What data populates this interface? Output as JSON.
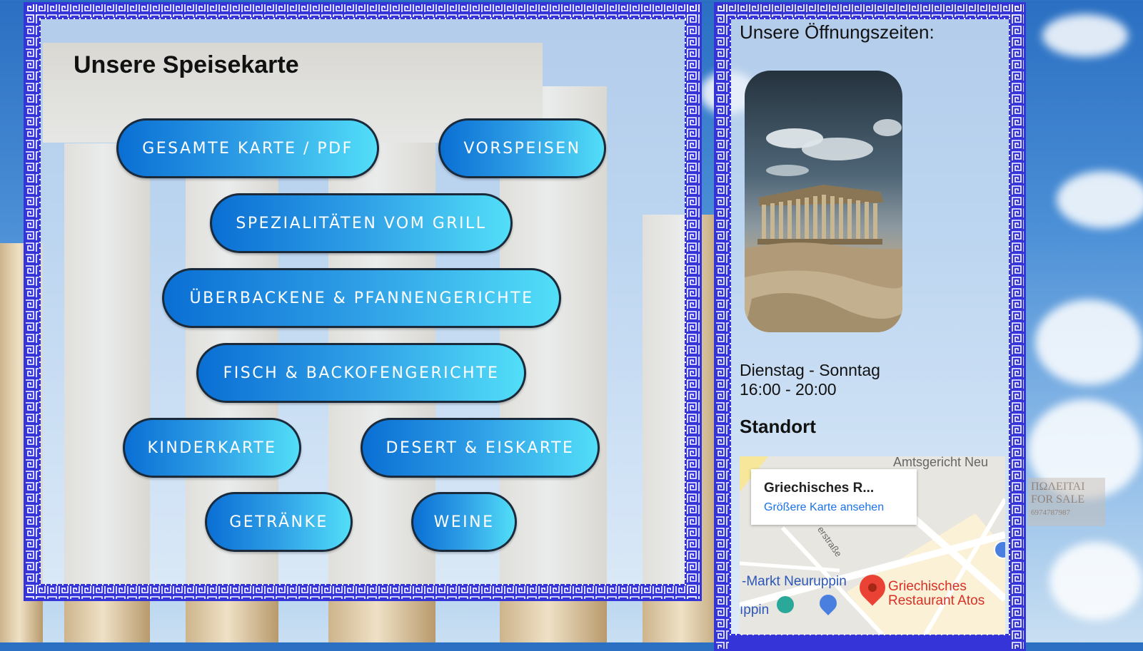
{
  "menu": {
    "title": "Unsere Speisekarte",
    "buttons": [
      "GESAMTE KARTE / PDF",
      "VORSPEISEN",
      "SPEZIALITÄTEN VOM GRILL",
      "ÜBERBACKENE & PFANNENGERICHTE",
      "FISCH & BACKOFENGERICHTE",
      "KINDERKARTE",
      "DESERT & EISKARTE",
      "GETRÄNKE",
      "WEINE"
    ]
  },
  "sidebar": {
    "hours_title": "Unsere Öffnungszeiten:",
    "days": "Dienstag - Sonntag",
    "time": "16:00 - 20:00",
    "location_title": "Standort",
    "map": {
      "card_title": "Griechisches R...",
      "card_link": "Größere Karte ansehen",
      "label_court": "Amtsgericht Neu",
      "label_street": "erstraße",
      "label_market": "-Markt Neuruppin",
      "label_partial": "ıppin",
      "pin_label_line1": "Griechisches",
      "pin_label_line2": "Restaurant Atos"
    }
  },
  "background": {
    "sign_line1": "ΠΩΛΕΙΤΑΙ",
    "sign_line2": "FOR SALE",
    "sign_line3": "6974787987"
  },
  "colors": {
    "frame": "#3434d8",
    "button_start": "#0a6fd4",
    "button_end": "#52def8",
    "map_pin": "#ea4335",
    "map_link": "#1a73e8"
  }
}
